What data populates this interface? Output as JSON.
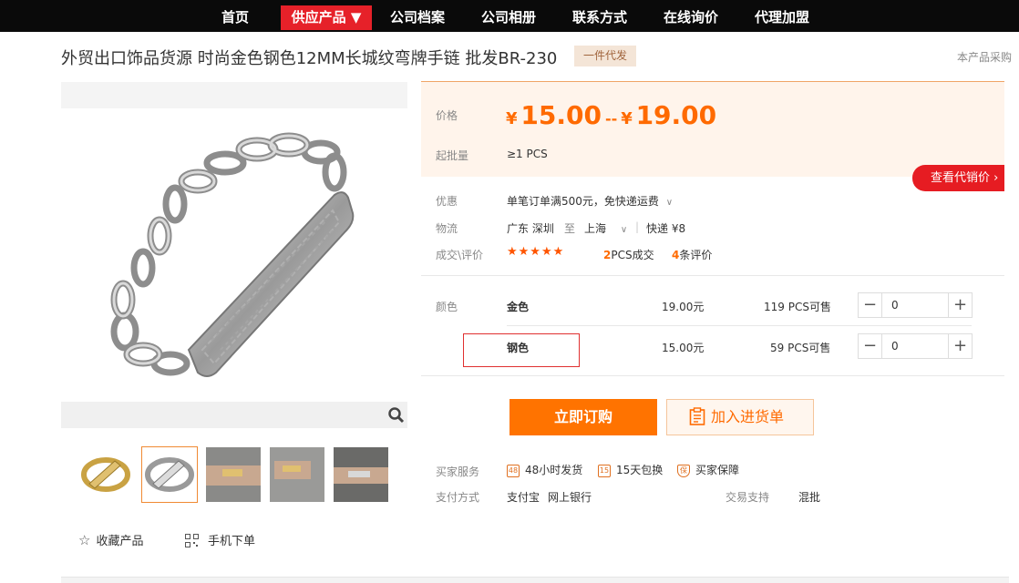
{
  "nav": {
    "items": [
      {
        "label": "首页"
      },
      {
        "label": "供应产品 ▼"
      },
      {
        "label": "公司档案"
      },
      {
        "label": "公司相册"
      },
      {
        "label": "联系方式"
      },
      {
        "label": "在线询价"
      },
      {
        "label": "代理加盟"
      }
    ],
    "active_index": 1
  },
  "product": {
    "title": "外贸出口饰品货源 时尚金色钢色12MM长城纹弯牌手链 批发BR-230",
    "badge": "一件代发",
    "note": "本产品采购"
  },
  "pricing": {
    "price_label": "价格",
    "currency": "¥",
    "price_low": "15.00",
    "dash": "--",
    "price_high": "19.00",
    "moq_label": "起批量",
    "moq_value": "≥1  PCS",
    "agent_button": "查看代销价 ›"
  },
  "info": {
    "discount_label": "优惠",
    "discount_value": "单笔订单满500元，免快递运费",
    "logistics_label": "物流",
    "from": "广东 深圳",
    "to_word": "至",
    "dest": "上海",
    "shipping": "快递 ¥8",
    "deals_label": "成交\\评价",
    "stars": "★★★★★",
    "deal_count": "2",
    "deal_unit": "PCS成交",
    "review_count": "4",
    "review_unit": "条评价"
  },
  "sku": {
    "color_label": "颜色",
    "rows": [
      {
        "name": "金色",
        "price": "19.00元",
        "stock": "119 PCS可售",
        "qty": "0"
      },
      {
        "name": "钢色",
        "price": "15.00元",
        "stock": "59 PCS可售",
        "qty": "0"
      }
    ]
  },
  "buttons": {
    "buy_now": "立即订购",
    "add_cart": "加入进货单"
  },
  "services": {
    "label": "买家服务",
    "items": [
      {
        "icon": "48",
        "label": "48小时发货"
      },
      {
        "icon": "15",
        "label": "15天包换"
      },
      {
        "icon": "保",
        "label": "买家保障"
      }
    ],
    "pay_label": "支付方式",
    "pay_1": "支付宝",
    "pay_2": "网上银行",
    "trade_label": "交易支持",
    "trade_value": "混批"
  },
  "actions": {
    "favorite": "收藏产品",
    "mobile": "手机下单"
  },
  "colors": {
    "accent": "#ff6a00",
    "nav_active": "#e62129",
    "agent_button": "#e61c22"
  }
}
